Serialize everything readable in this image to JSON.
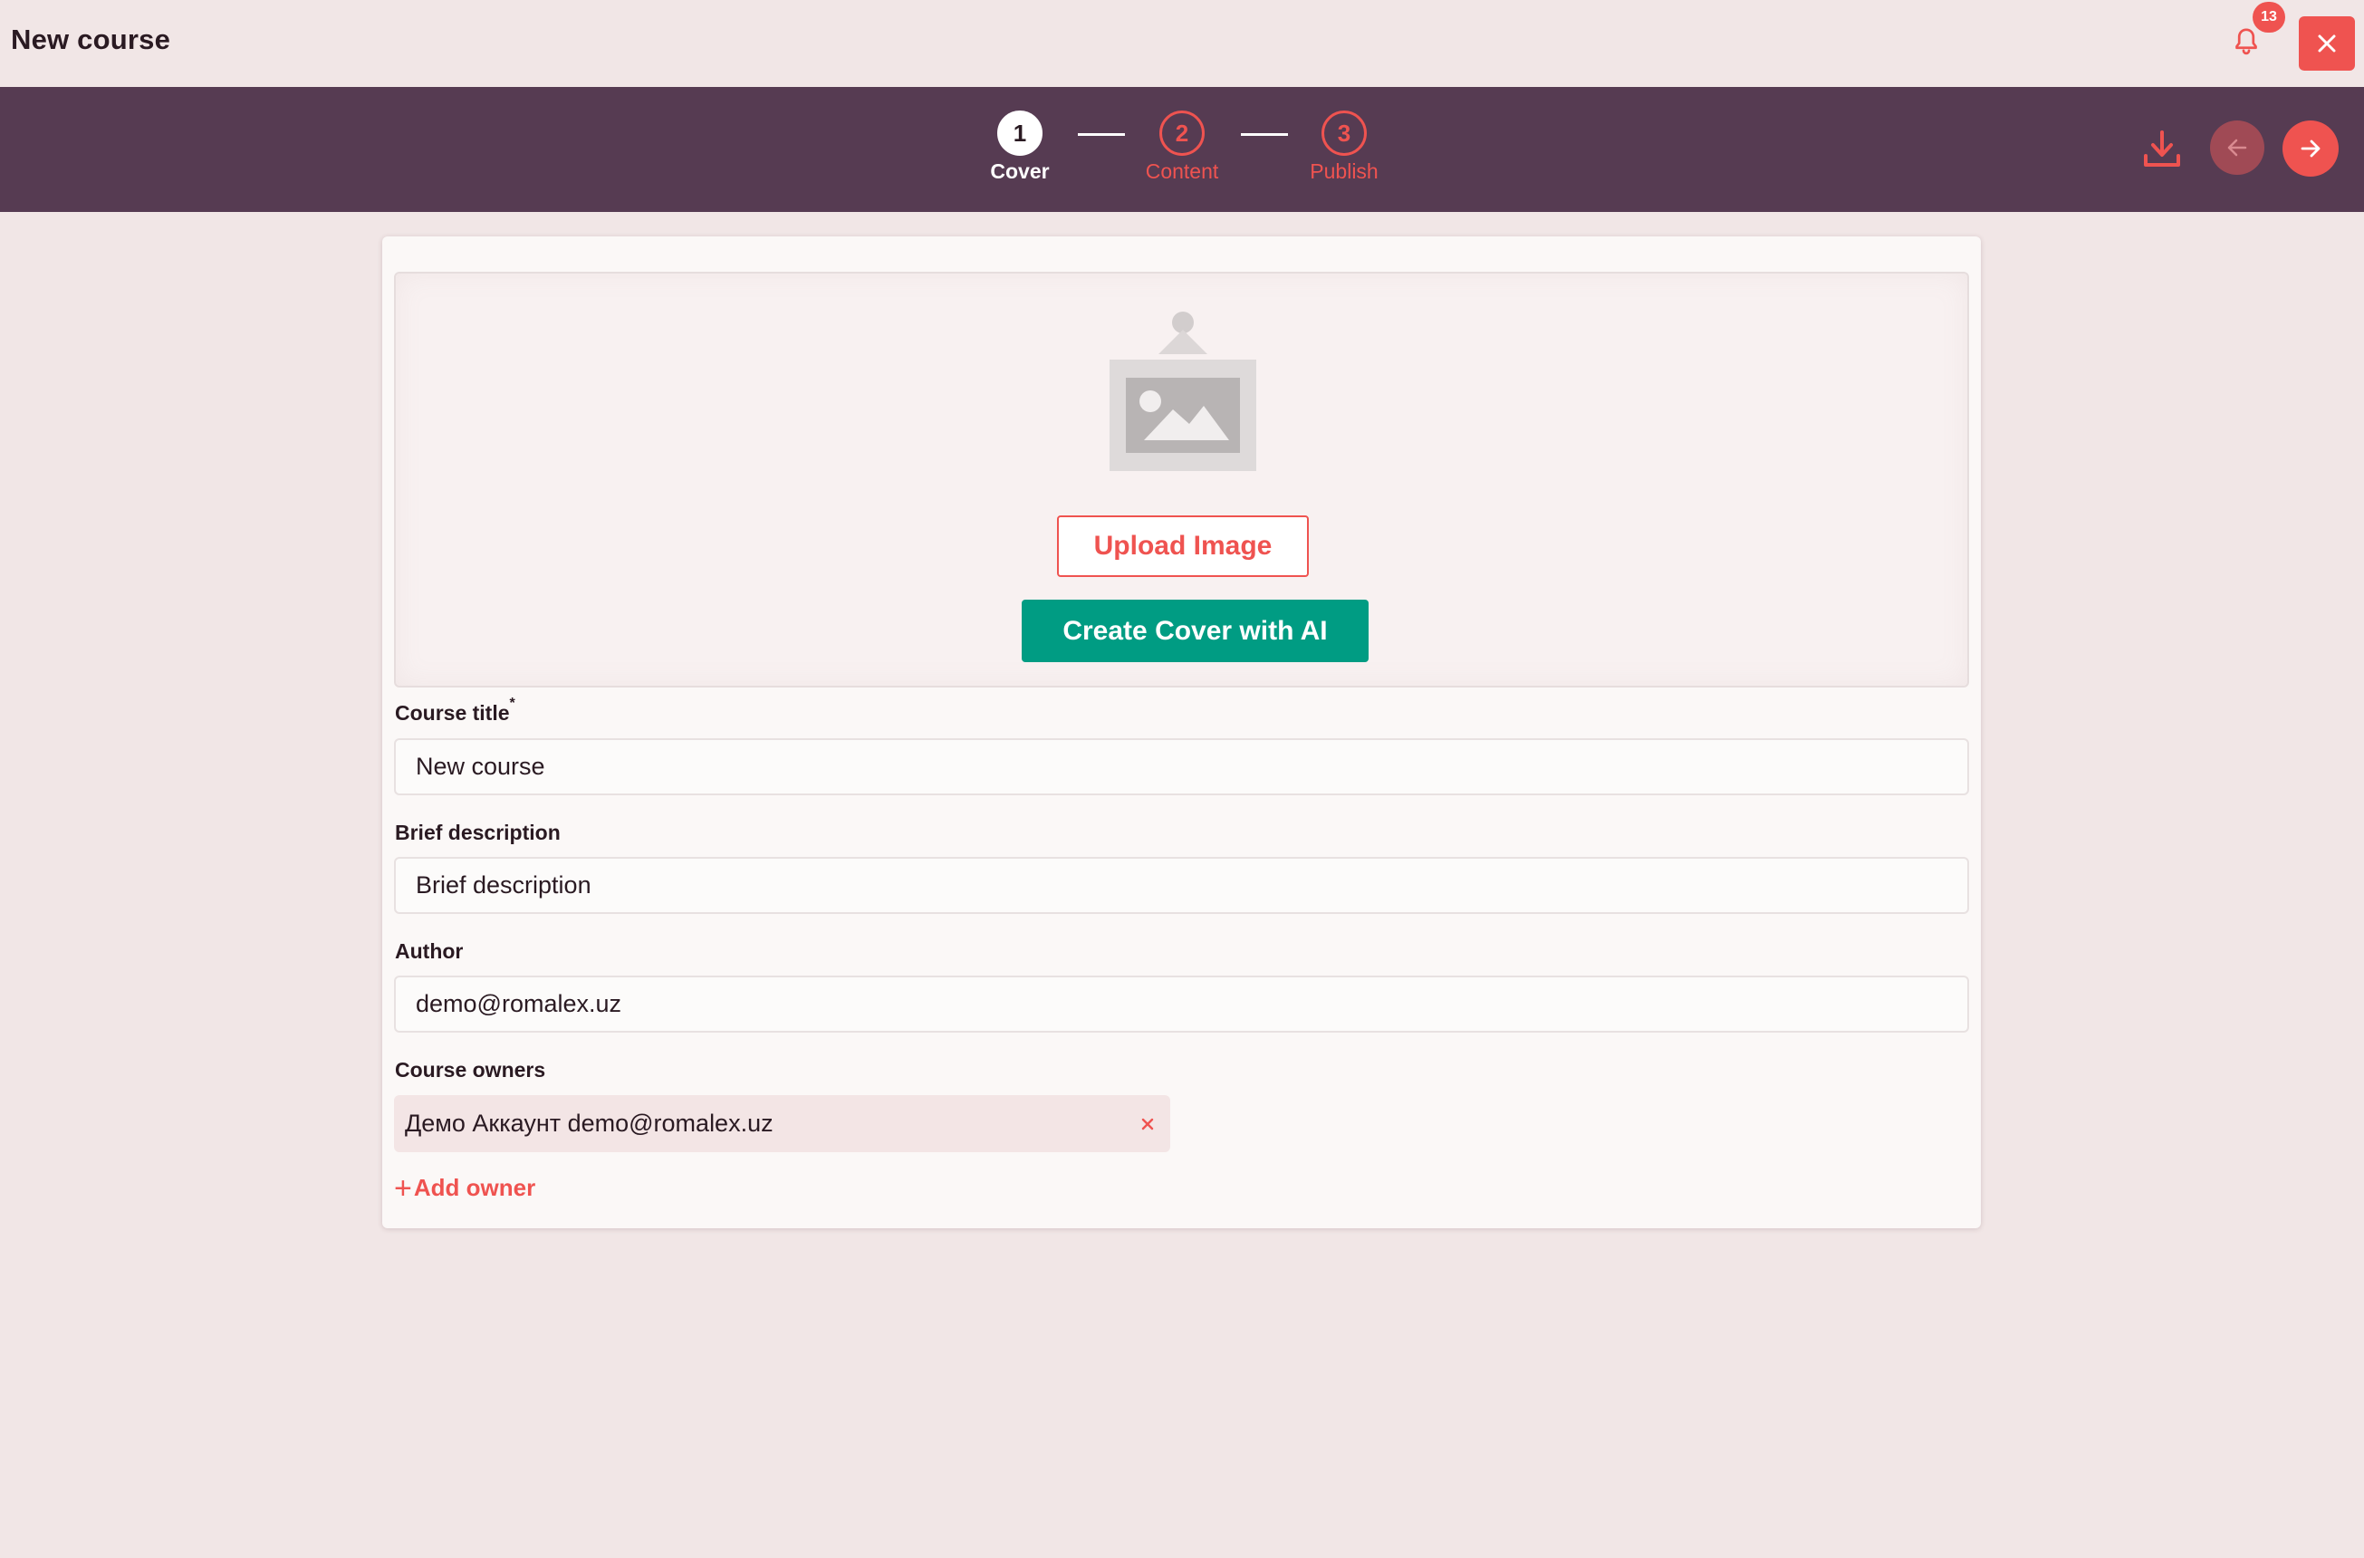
{
  "header": {
    "title": "New course",
    "notifications_count": "13",
    "colors": {
      "accent": "#ef5350",
      "background": "#f1e6e6"
    }
  },
  "stepper": {
    "background": "#563b52",
    "steps": [
      {
        "number": "1",
        "label": "Cover",
        "state": "active"
      },
      {
        "number": "2",
        "label": "Content",
        "state": "inactive"
      },
      {
        "number": "3",
        "label": "Publish",
        "state": "inactive"
      }
    ],
    "actions": {
      "download_icon": "download-icon",
      "back_icon": "arrow-left-icon",
      "next_icon": "arrow-right-icon"
    }
  },
  "cover": {
    "placeholder_icon": "image-placeholder-icon",
    "upload_label": "Upload Image",
    "ai_label": "Create Cover with AI",
    "ai_color": "#009c83"
  },
  "form": {
    "title": {
      "label": "Course title",
      "required_mark": "*",
      "value": "New course"
    },
    "description": {
      "label": "Brief description",
      "placeholder": "Brief description",
      "value": ""
    },
    "author": {
      "label": "Author",
      "value": "demo@romalex.uz"
    },
    "owners": {
      "label": "Course owners",
      "items": [
        {
          "text": "Демо Аккаунт demo@romalex.uz"
        }
      ],
      "add_label": "Add owner",
      "add_prefix": "+"
    }
  }
}
